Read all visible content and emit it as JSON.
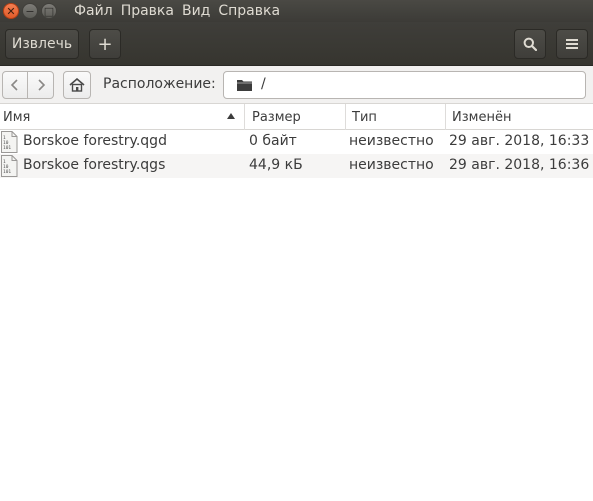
{
  "titlebar": {
    "menu": [
      "Файл",
      "Правка",
      "Вид",
      "Справка"
    ]
  },
  "toolbar": {
    "eject_label": "Извлечь",
    "add_label": "+",
    "search_icon": "search-icon",
    "menu_icon": "hamburger-menu-icon"
  },
  "location": {
    "label": "Расположение:",
    "path": "/"
  },
  "columns": {
    "name": "Имя",
    "size": "Размер",
    "type": "Тип",
    "modified": "Изменён"
  },
  "files": [
    {
      "name": "Borskoe forestry.qgd",
      "size": "0 байт",
      "type": "неизвестно",
      "modified": "29 авг. 2018, 16:33"
    },
    {
      "name": "Borskoe forestry.qgs",
      "size": "44,9 кБ",
      "type": "неизвестно",
      "modified": "29 авг. 2018, 16:36"
    }
  ],
  "colors": {
    "titlebar_bg": "#3c3b37",
    "close_button": "#e95420",
    "row_alt": "#f6f5f4"
  }
}
